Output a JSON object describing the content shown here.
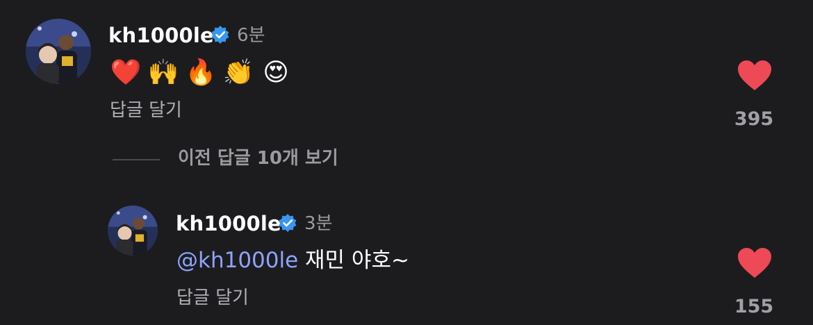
{
  "comment": {
    "username": "kh1000le",
    "time": "6분",
    "emojis": [
      "❤️",
      "🙌",
      "🔥",
      "👏",
      "😍"
    ],
    "reply_label": "답글 달기",
    "like_count": "395",
    "heart_icon": "heart-icon",
    "verified_icon": "verified-badge-icon"
  },
  "view_previous_replies": "이전 답글 10개 보기",
  "reply": {
    "username": "kh1000le",
    "time": "3분",
    "mention": "@kh1000le",
    "text": " 재민 야호~",
    "reply_label": "답글 달기",
    "like_count": "155"
  },
  "colors": {
    "background": "#1c1c1e",
    "heart": "#ed4956",
    "verified": "#3897f0",
    "mention": "#8ea4ff"
  }
}
